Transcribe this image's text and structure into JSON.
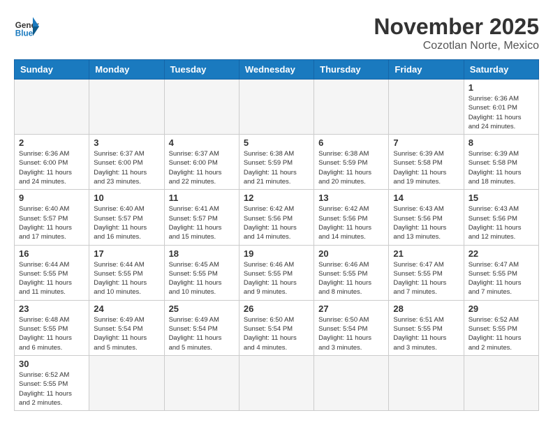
{
  "header": {
    "logo_general": "General",
    "logo_blue": "Blue",
    "month_title": "November 2025",
    "location": "Cozotlan Norte, Mexico"
  },
  "days_of_week": [
    "Sunday",
    "Monday",
    "Tuesday",
    "Wednesday",
    "Thursday",
    "Friday",
    "Saturday"
  ],
  "weeks": [
    [
      {
        "day": "",
        "info": ""
      },
      {
        "day": "",
        "info": ""
      },
      {
        "day": "",
        "info": ""
      },
      {
        "day": "",
        "info": ""
      },
      {
        "day": "",
        "info": ""
      },
      {
        "day": "",
        "info": ""
      },
      {
        "day": "1",
        "info": "Sunrise: 6:36 AM\nSunset: 6:01 PM\nDaylight: 11 hours\nand 24 minutes."
      }
    ],
    [
      {
        "day": "2",
        "info": "Sunrise: 6:36 AM\nSunset: 6:00 PM\nDaylight: 11 hours\nand 24 minutes."
      },
      {
        "day": "3",
        "info": "Sunrise: 6:37 AM\nSunset: 6:00 PM\nDaylight: 11 hours\nand 23 minutes."
      },
      {
        "day": "4",
        "info": "Sunrise: 6:37 AM\nSunset: 6:00 PM\nDaylight: 11 hours\nand 22 minutes."
      },
      {
        "day": "5",
        "info": "Sunrise: 6:38 AM\nSunset: 5:59 PM\nDaylight: 11 hours\nand 21 minutes."
      },
      {
        "day": "6",
        "info": "Sunrise: 6:38 AM\nSunset: 5:59 PM\nDaylight: 11 hours\nand 20 minutes."
      },
      {
        "day": "7",
        "info": "Sunrise: 6:39 AM\nSunset: 5:58 PM\nDaylight: 11 hours\nand 19 minutes."
      },
      {
        "day": "8",
        "info": "Sunrise: 6:39 AM\nSunset: 5:58 PM\nDaylight: 11 hours\nand 18 minutes."
      }
    ],
    [
      {
        "day": "9",
        "info": "Sunrise: 6:40 AM\nSunset: 5:57 PM\nDaylight: 11 hours\nand 17 minutes."
      },
      {
        "day": "10",
        "info": "Sunrise: 6:40 AM\nSunset: 5:57 PM\nDaylight: 11 hours\nand 16 minutes."
      },
      {
        "day": "11",
        "info": "Sunrise: 6:41 AM\nSunset: 5:57 PM\nDaylight: 11 hours\nand 15 minutes."
      },
      {
        "day": "12",
        "info": "Sunrise: 6:42 AM\nSunset: 5:56 PM\nDaylight: 11 hours\nand 14 minutes."
      },
      {
        "day": "13",
        "info": "Sunrise: 6:42 AM\nSunset: 5:56 PM\nDaylight: 11 hours\nand 14 minutes."
      },
      {
        "day": "14",
        "info": "Sunrise: 6:43 AM\nSunset: 5:56 PM\nDaylight: 11 hours\nand 13 minutes."
      },
      {
        "day": "15",
        "info": "Sunrise: 6:43 AM\nSunset: 5:56 PM\nDaylight: 11 hours\nand 12 minutes."
      }
    ],
    [
      {
        "day": "16",
        "info": "Sunrise: 6:44 AM\nSunset: 5:55 PM\nDaylight: 11 hours\nand 11 minutes."
      },
      {
        "day": "17",
        "info": "Sunrise: 6:44 AM\nSunset: 5:55 PM\nDaylight: 11 hours\nand 10 minutes."
      },
      {
        "day": "18",
        "info": "Sunrise: 6:45 AM\nSunset: 5:55 PM\nDaylight: 11 hours\nand 10 minutes."
      },
      {
        "day": "19",
        "info": "Sunrise: 6:46 AM\nSunset: 5:55 PM\nDaylight: 11 hours\nand 9 minutes."
      },
      {
        "day": "20",
        "info": "Sunrise: 6:46 AM\nSunset: 5:55 PM\nDaylight: 11 hours\nand 8 minutes."
      },
      {
        "day": "21",
        "info": "Sunrise: 6:47 AM\nSunset: 5:55 PM\nDaylight: 11 hours\nand 7 minutes."
      },
      {
        "day": "22",
        "info": "Sunrise: 6:47 AM\nSunset: 5:55 PM\nDaylight: 11 hours\nand 7 minutes."
      }
    ],
    [
      {
        "day": "23",
        "info": "Sunrise: 6:48 AM\nSunset: 5:55 PM\nDaylight: 11 hours\nand 6 minutes."
      },
      {
        "day": "24",
        "info": "Sunrise: 6:49 AM\nSunset: 5:54 PM\nDaylight: 11 hours\nand 5 minutes."
      },
      {
        "day": "25",
        "info": "Sunrise: 6:49 AM\nSunset: 5:54 PM\nDaylight: 11 hours\nand 5 minutes."
      },
      {
        "day": "26",
        "info": "Sunrise: 6:50 AM\nSunset: 5:54 PM\nDaylight: 11 hours\nand 4 minutes."
      },
      {
        "day": "27",
        "info": "Sunrise: 6:50 AM\nSunset: 5:54 PM\nDaylight: 11 hours\nand 3 minutes."
      },
      {
        "day": "28",
        "info": "Sunrise: 6:51 AM\nSunset: 5:55 PM\nDaylight: 11 hours\nand 3 minutes."
      },
      {
        "day": "29",
        "info": "Sunrise: 6:52 AM\nSunset: 5:55 PM\nDaylight: 11 hours\nand 2 minutes."
      }
    ],
    [
      {
        "day": "30",
        "info": "Sunrise: 6:52 AM\nSunset: 5:55 PM\nDaylight: 11 hours\nand 2 minutes."
      },
      {
        "day": "",
        "info": ""
      },
      {
        "day": "",
        "info": ""
      },
      {
        "day": "",
        "info": ""
      },
      {
        "day": "",
        "info": ""
      },
      {
        "day": "",
        "info": ""
      },
      {
        "day": "",
        "info": ""
      }
    ]
  ]
}
